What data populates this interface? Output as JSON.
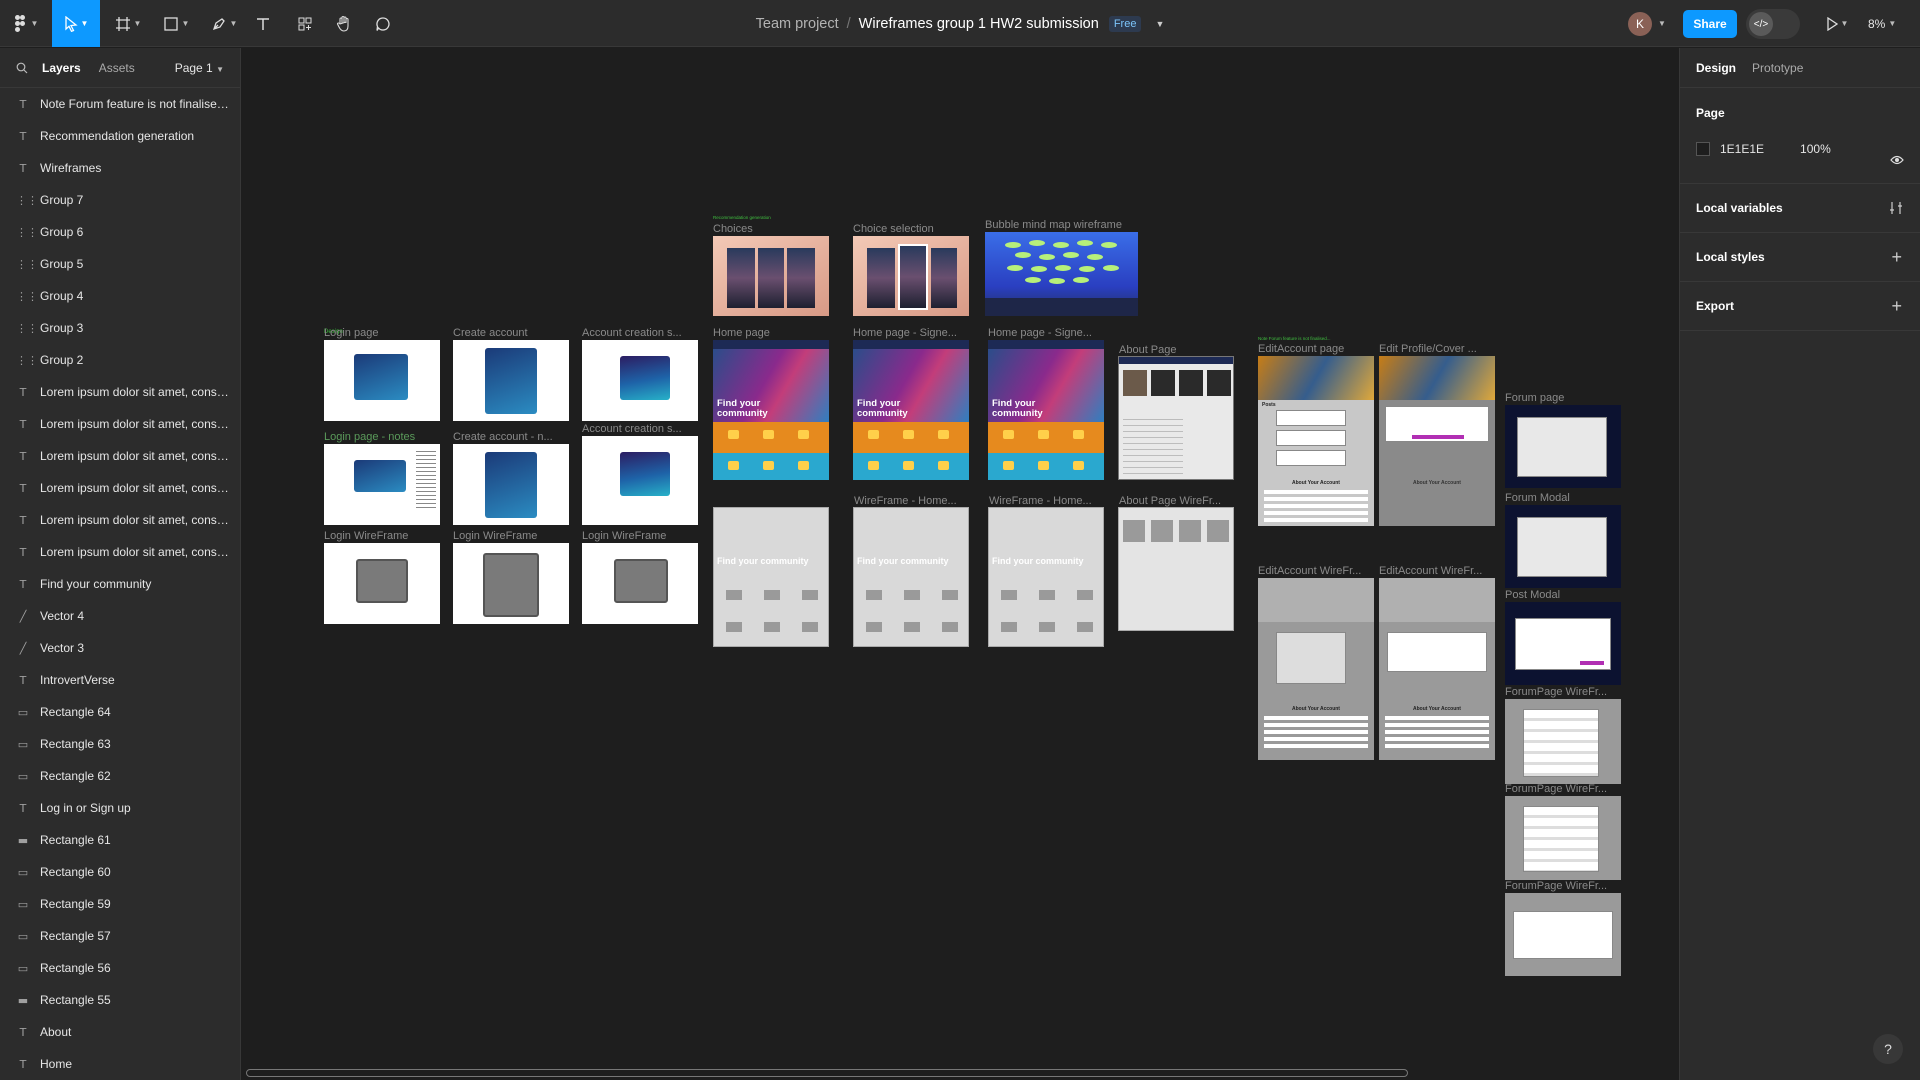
{
  "toolbar": {
    "team": "Team project",
    "file": "Wireframes group 1 HW2 submission",
    "plan_badge": "Free",
    "user_initial": "K",
    "share_label": "Share",
    "zoom": "8%"
  },
  "left_panel": {
    "tabs": [
      "Layers",
      "Assets"
    ],
    "page_selector": "Page 1",
    "layers": [
      {
        "icon": "text",
        "name": "Note Forum feature is not finalised..."
      },
      {
        "icon": "text",
        "name": "Recommendation generation"
      },
      {
        "icon": "text",
        "name": "Wireframes"
      },
      {
        "icon": "group",
        "name": "Group 7"
      },
      {
        "icon": "group",
        "name": "Group 6"
      },
      {
        "icon": "group",
        "name": "Group 5"
      },
      {
        "icon": "group",
        "name": "Group 4"
      },
      {
        "icon": "group",
        "name": "Group 3"
      },
      {
        "icon": "group",
        "name": "Group 2"
      },
      {
        "icon": "text",
        "name": "Lorem ipsum dolor sit amet, conse..."
      },
      {
        "icon": "text",
        "name": "Lorem ipsum dolor sit amet, conse..."
      },
      {
        "icon": "text",
        "name": "Lorem ipsum dolor sit amet, conse..."
      },
      {
        "icon": "text",
        "name": "Lorem ipsum dolor sit amet, conse..."
      },
      {
        "icon": "text",
        "name": "Lorem ipsum dolor sit amet, conse..."
      },
      {
        "icon": "text",
        "name": "Lorem ipsum dolor sit amet, conse..."
      },
      {
        "icon": "text",
        "name": "Find your community"
      },
      {
        "icon": "vector",
        "name": "Vector 4"
      },
      {
        "icon": "vector",
        "name": "Vector 3"
      },
      {
        "icon": "text",
        "name": "IntrovertVerse"
      },
      {
        "icon": "rect",
        "name": "Rectangle 64"
      },
      {
        "icon": "rect",
        "name": "Rectangle 63"
      },
      {
        "icon": "rect",
        "name": "Rectangle 62"
      },
      {
        "icon": "text",
        "name": "Log in or Sign up"
      },
      {
        "icon": "line",
        "name": "Rectangle 61"
      },
      {
        "icon": "rect",
        "name": "Rectangle 60"
      },
      {
        "icon": "rect",
        "name": "Rectangle 59"
      },
      {
        "icon": "rect",
        "name": "Rectangle 57"
      },
      {
        "icon": "rect",
        "name": "Rectangle 56"
      },
      {
        "icon": "line",
        "name": "Rectangle 55"
      },
      {
        "icon": "text",
        "name": "About"
      },
      {
        "icon": "text",
        "name": "Home"
      }
    ]
  },
  "right_panel": {
    "tabs": [
      "Design",
      "Prototype"
    ],
    "page_heading": "Page",
    "page_color": "1E1E1E",
    "page_opacity": "100%",
    "sections": [
      "Local variables",
      "Local styles",
      "Export"
    ]
  },
  "canvas": {
    "frames": {
      "choices": "Choices",
      "choice_selection": "Choice selection",
      "bubble": "Bubble mind map wireframe",
      "login_page": "Login page",
      "create_account": "Create account",
      "account_creation_1": "Account creation s...",
      "home_page": "Home page",
      "home_signed_1": "Home page - Signe...",
      "home_signed_2": "Home page - Signe...",
      "about_page": "About Page",
      "edit_account": "EditAccount page",
      "edit_profile": "Edit Profile/Cover ...",
      "forum_page": "Forum page",
      "login_notes": "Login page - notes",
      "create_account_notes": "Create account - n...",
      "account_creation_2": "Account creation s...",
      "forum_modal": "Forum Modal",
      "login_wf_1": "Login WireFrame",
      "login_wf_2": "Login WireFrame",
      "login_wf_3": "Login WireFrame",
      "home_wf_1": "WireFrame - Home...",
      "home_wf_2": "WireFrame - Home...",
      "about_wf": "About Page WireFr...",
      "post_modal": "Post Modal",
      "edit_account_wf_1": "EditAccount WireFr...",
      "edit_account_wf_2": "EditAccount WireFr...",
      "forum_wf_1": "ForumPage WireFr...",
      "forum_wf_2": "ForumPage WireFr...",
      "forum_wf_3": "ForumPage WireFr..."
    },
    "hero_text": "Find your community",
    "about_account": "About Your Account",
    "posts_label": "Posts"
  },
  "colors": {
    "accent": "#0d99ff",
    "canvas_bg": "#1e1e1e",
    "panel_bg": "#2c2c2c"
  }
}
